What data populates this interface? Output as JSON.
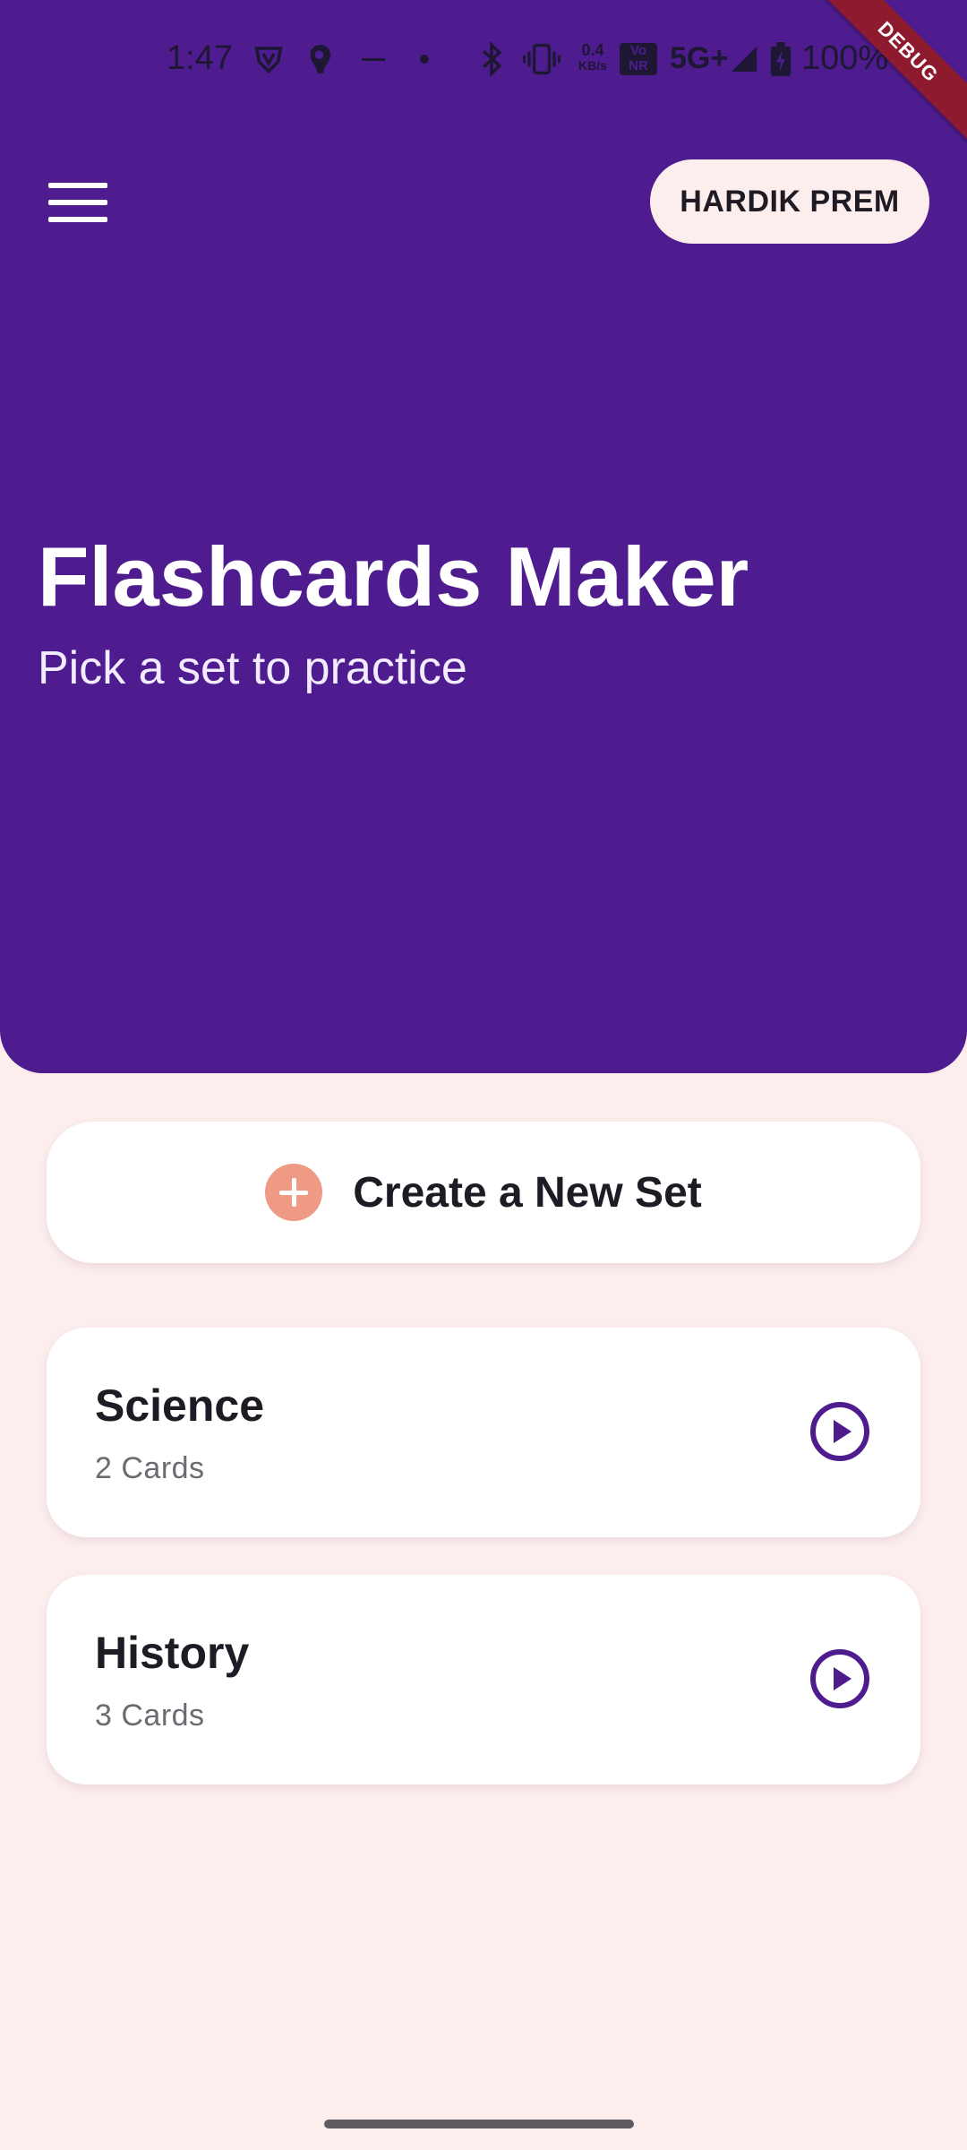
{
  "status_bar": {
    "time": "1:47",
    "network_speed_value": "0.4",
    "network_speed_unit": "KB/s",
    "volte_label_top": "Vo",
    "volte_label_bottom": "NR",
    "network_type": "5G+",
    "battery": "100%",
    "icons": [
      "vpn-icon",
      "app-notification-icon",
      "dash-icon",
      "dot-icon",
      "bluetooth-icon",
      "vibrate-icon",
      "signal-icon",
      "battery-icon"
    ]
  },
  "debug_banner": "DEBUG",
  "app_bar": {
    "menu_icon": "hamburger-menu-icon",
    "user_name": "HARDIK PREM"
  },
  "header": {
    "title": "Flashcards Maker",
    "subtitle": "Pick a set to practice"
  },
  "create_button": {
    "label": "Create a New Set",
    "icon": "plus-circle-icon"
  },
  "sets": [
    {
      "title": "Science",
      "count": "2 Cards",
      "icon": "play-circle-icon"
    },
    {
      "title": "History",
      "count": "3 Cards",
      "icon": "play-circle-icon"
    }
  ],
  "colors": {
    "primary": "#4e1c8e",
    "background": "#fdeeee",
    "accent": "#ef9a85",
    "card": "#ffffff"
  }
}
